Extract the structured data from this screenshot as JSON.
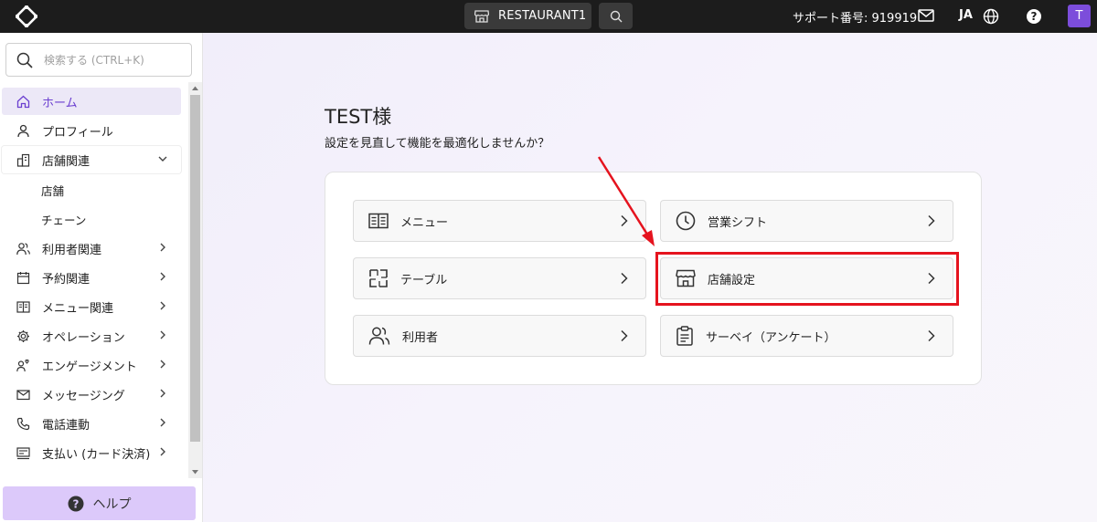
{
  "topbar": {
    "store_name": "RESTAURANT1",
    "support_text": "サポート番号: 919919",
    "language": "JA",
    "avatar_initial": "T"
  },
  "sidebar": {
    "search_placeholder": "検索する (CTRL+K)",
    "items": [
      {
        "label": "ホーム",
        "icon": "home-icon",
        "active": true
      },
      {
        "label": "プロフィール",
        "icon": "person-icon"
      },
      {
        "label": "店舗関連",
        "icon": "buildings-icon",
        "expanded": true
      },
      {
        "label": "店舗",
        "sub": true
      },
      {
        "label": "チェーン",
        "sub": true
      },
      {
        "label": "利用者関連",
        "icon": "users-icon"
      },
      {
        "label": "予約関連",
        "icon": "calendar-icon"
      },
      {
        "label": "メニュー関連",
        "icon": "menu-book-icon"
      },
      {
        "label": "オペレーション",
        "icon": "gear-icon"
      },
      {
        "label": "エンゲージメント",
        "icon": "engagement-icon"
      },
      {
        "label": "メッセージング",
        "icon": "mail-icon"
      },
      {
        "label": "電話連動",
        "icon": "phone-icon"
      },
      {
        "label": "支払い (カード決済)",
        "icon": "payment-icon"
      }
    ],
    "help_label": "ヘルプ"
  },
  "main": {
    "title": "TEST様",
    "subtitle": "設定を見直して機能を最適化しませんか？",
    "tiles": [
      {
        "label": "メニュー",
        "icon": "menu-book-icon"
      },
      {
        "label": "営業シフト",
        "icon": "clock-icon"
      },
      {
        "label": "テーブル",
        "icon": "table-icon"
      },
      {
        "label": "店舗設定",
        "icon": "storefront-icon"
      },
      {
        "label": "利用者",
        "icon": "users-icon"
      },
      {
        "label": "サーベイ（アンケート）",
        "icon": "clipboard-icon"
      }
    ]
  },
  "colors": {
    "accent": "#7c4ddb",
    "highlight": "#e5131e",
    "help_bg": "#dcc9fa"
  }
}
